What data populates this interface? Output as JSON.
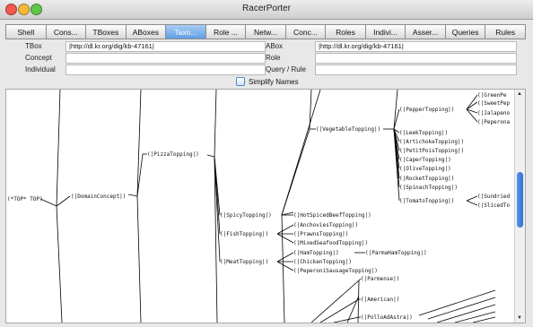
{
  "window": {
    "title": "RacerPorter"
  },
  "tabs": [
    {
      "label": "Shell",
      "active": false
    },
    {
      "label": "Cons...",
      "active": false
    },
    {
      "label": "TBoxes",
      "active": false
    },
    {
      "label": "ABoxes",
      "active": false
    },
    {
      "label": "Taxo...",
      "active": true
    },
    {
      "label": "Role ...",
      "active": false
    },
    {
      "label": "Netw...",
      "active": false
    },
    {
      "label": "Conc...",
      "active": false
    },
    {
      "label": "Roles",
      "active": false
    },
    {
      "label": "Indivi...",
      "active": false
    },
    {
      "label": "Asser...",
      "active": false
    },
    {
      "label": "Queries",
      "active": false
    },
    {
      "label": "Rules",
      "active": false
    }
  ],
  "form": {
    "tbox_label": "TBox",
    "tbox_value": "|http://dl.kr.org/dig/kb-47161|",
    "abox_label": "ABox",
    "abox_value": "|http://dl.kr.org/dig/kb-47161|",
    "concept_label": "Concept",
    "concept_value": "",
    "role_label": "Role",
    "role_value": "",
    "individual_label": "Individual",
    "individual_value": "",
    "query_label": "Query / Rule",
    "query_value": ""
  },
  "simplify": {
    "label": "Simplify Names",
    "checked": false
  },
  "graph": {
    "root": "(*TOP* TOP)",
    "domain": "(|DomainConcept|)",
    "pizza": "(|PizzaTopping|)",
    "vegetable": "(|VegetableTopping|)",
    "pepper": "(|PepperTopping|)",
    "pepper_children": [
      "(|GreenPe",
      "(|SweetPep",
      "(|Jalapeno",
      "(|Peperona"
    ],
    "veg_children": [
      "(|LeekTopping|)",
      "(|ArtichokeTopping|)",
      "(|PetitPoisTopping|)",
      "(|CaperTopping|)",
      "(|OliveTopping|)",
      "(|RocketTopping|)",
      "(|SpinachTopping|)"
    ],
    "tomato": "(|TomatoTopping|)",
    "tomato_children": [
      "(|Sundried",
      "(|SlicedTo"
    ],
    "spicy": "(|SpicyTopping|)",
    "hotbeef": "(|HotSpicedBeefTopping|)",
    "fish": "(|FishTopping|)",
    "fish_children": [
      "(|AnchoviesTopping|)",
      "(|PrawnsTopping|)",
      "(|MixedSeafoodTopping|)"
    ],
    "meat": "(|MeatTopping|)",
    "ham": "(|HamTopping|)",
    "parmaham": "(|ParmaHamTopping|)",
    "meat_children": [
      "(|ChickenTopping|)",
      "(|PeperoniSausageTopping|)"
    ],
    "lower": [
      "(|Parmense|)",
      "(|American|)",
      "(|PolloAdAstra|)"
    ]
  }
}
